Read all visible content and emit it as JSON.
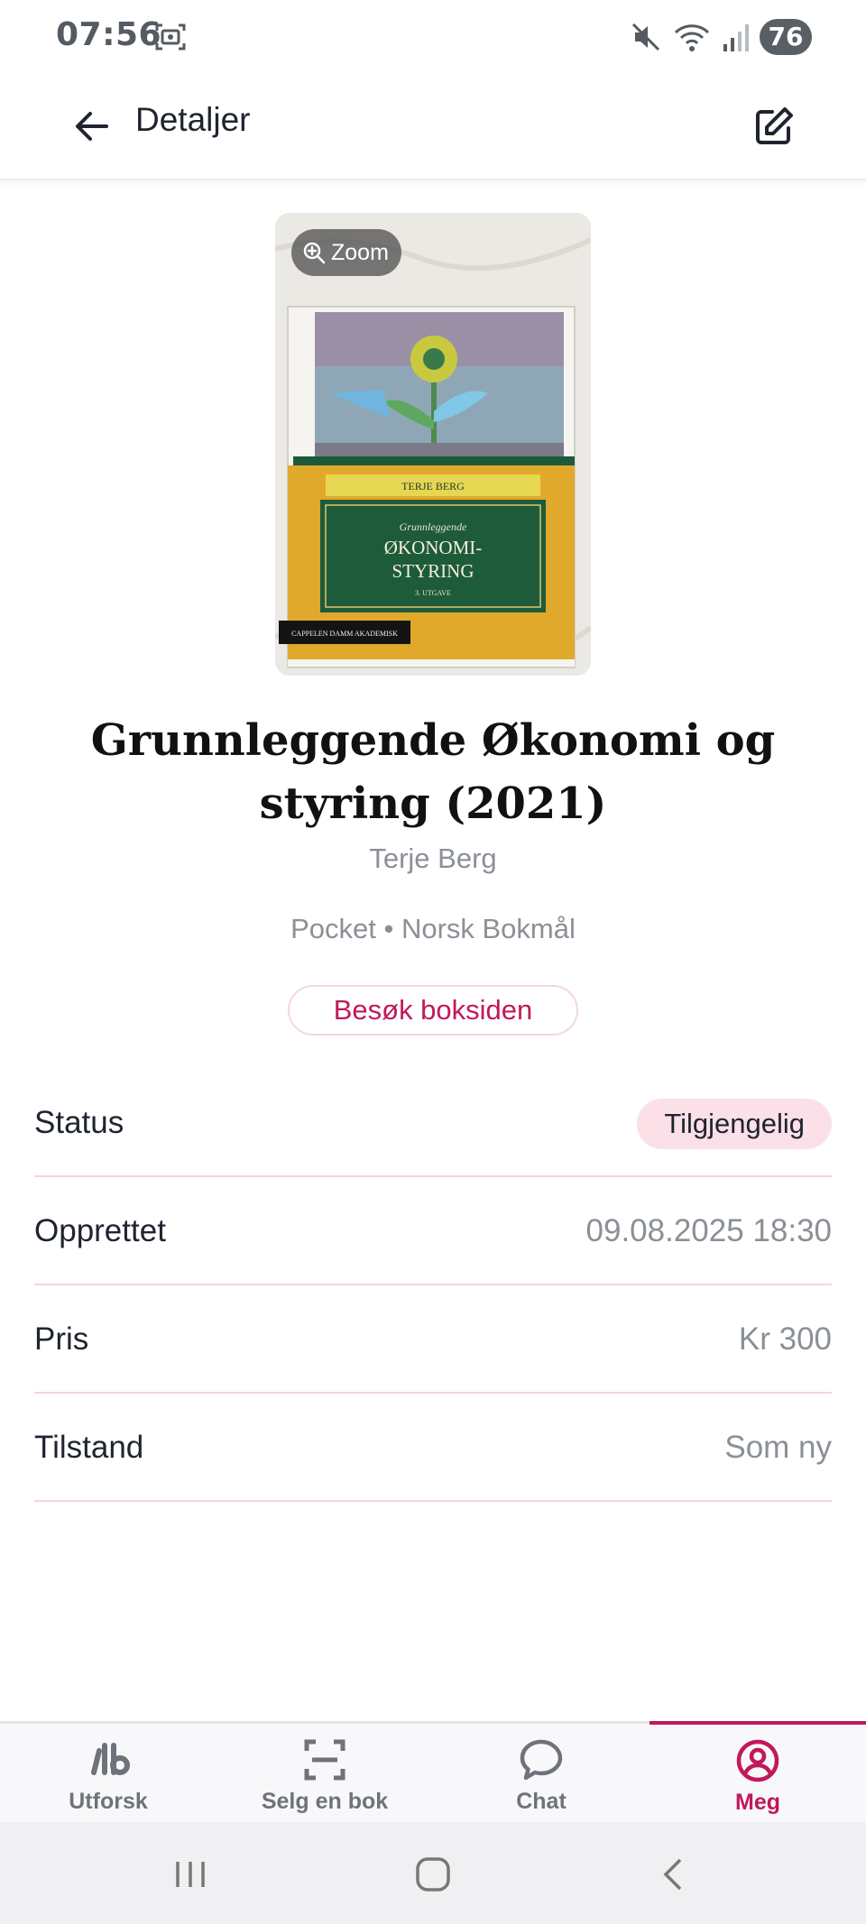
{
  "status_bar": {
    "time": "07:56",
    "battery": "76",
    "icons": [
      "screenshot-icon",
      "mute-icon",
      "wifi-icon",
      "signal-icon",
      "battery-icon"
    ]
  },
  "app_bar": {
    "title": "Detaljer",
    "back_icon": "arrow-left-icon",
    "edit_icon": "edit-icon"
  },
  "cover": {
    "zoom_label": "Zoom",
    "cover_author": "TERJE BERG",
    "cover_kicker": "Grunnleggende",
    "cover_title_line1": "ØKONOMI-",
    "cover_title_line2": "STYRING",
    "cover_edition": "3. UTGAVE",
    "cover_publisher": "CAPPELEN DAMM AKADEMISK"
  },
  "book": {
    "title": "Grunnleggende Økonomi og styring (2021)",
    "author": "Terje Berg",
    "meta": "Pocket • Norsk Bokmål",
    "visit_label": "Besøk boksiden"
  },
  "details": {
    "status_label": "Status",
    "status_value": "Tilgjengelig",
    "created_label": "Opprettet",
    "created_value": "09.08.2025 18:30",
    "price_label": "Pris",
    "price_value": "Kr 300",
    "condition_label": "Tilstand",
    "condition_value": "Som ny"
  },
  "bottom_nav": {
    "items": [
      {
        "label": "Utforsk",
        "icon": "logo-icon"
      },
      {
        "label": "Selg en bok",
        "icon": "scan-icon"
      },
      {
        "label": "Chat",
        "icon": "chat-bubble-icon"
      },
      {
        "label": "Meg",
        "icon": "profile-icon",
        "active": true
      }
    ]
  },
  "colors": {
    "accent": "#c2185b",
    "pill_bg": "#fbe0e7",
    "divider": "#f4d4dd",
    "muted_text": "#8b9097"
  }
}
